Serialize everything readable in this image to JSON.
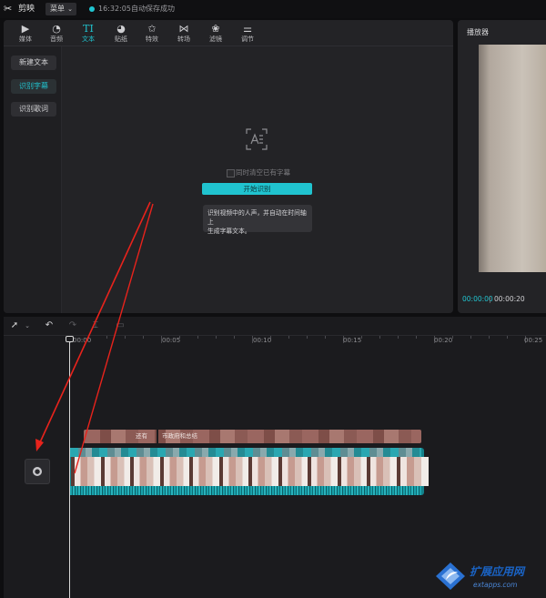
{
  "topbar": {
    "app_name": "剪映",
    "menu_label": "菜单",
    "save_time": "16:32:05",
    "save_status": "自动保存成功"
  },
  "tabs": [
    {
      "label": "媒体",
      "icon": "media-icon"
    },
    {
      "label": "音频",
      "icon": "audio-icon"
    },
    {
      "label": "文本",
      "icon": "text-icon",
      "active": true
    },
    {
      "label": "贴纸",
      "icon": "sticker-icon"
    },
    {
      "label": "特效",
      "icon": "effects-icon"
    },
    {
      "label": "转场",
      "icon": "transition-icon"
    },
    {
      "label": "滤镜",
      "icon": "filter-icon"
    },
    {
      "label": "调节",
      "icon": "adjust-icon"
    }
  ],
  "side": {
    "new_text": "新建文本",
    "recognize_subtitles": "识别字幕",
    "recognize_lyrics": "识别歌词"
  },
  "recognize": {
    "clear_label": "同时清空已有字幕",
    "start_button": "开始识别",
    "tooltip_line1": "识别视频中的人声，并自动在时间轴上",
    "tooltip_line2": "生成字幕文本。"
  },
  "player": {
    "title": "播放器",
    "time_current": "00:00:00",
    "time_total": "00:00:20"
  },
  "timeline": {
    "ruler": [
      "00:00",
      "00:05",
      "00:10",
      "00:15",
      "00:20",
      "00:25"
    ],
    "subtitle_1": "还有",
    "subtitle_2": "市政府和总结"
  },
  "watermark": {
    "name": "扩展应用网",
    "url": "extapps.com"
  },
  "colors": {
    "accent": "#21c4d0",
    "arrow": "#e8231c"
  }
}
